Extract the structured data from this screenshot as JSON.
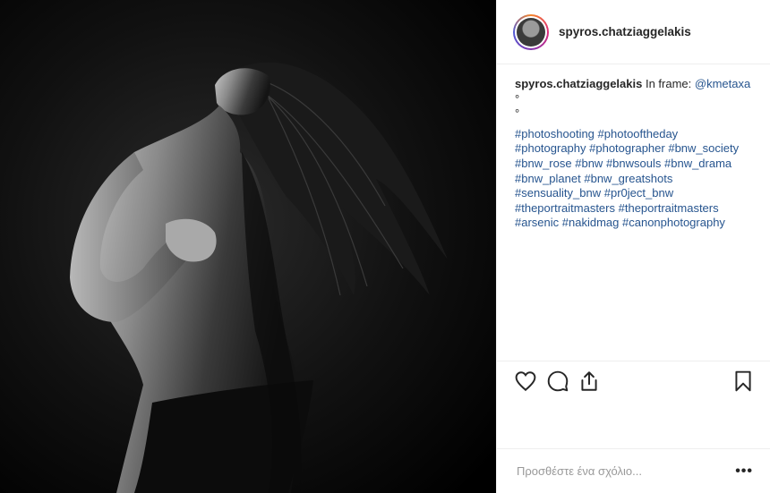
{
  "post": {
    "username": "spyros.chatziaggelakis",
    "caption": {
      "author": "spyros.chatziaggelakis",
      "text_prefix": "In frame:",
      "mention": "@kmetaxa",
      "dots": [
        "°",
        "°"
      ],
      "hashtag_lines": [
        [
          "#photoshooting",
          "#photooftheday"
        ],
        [
          "#photography",
          "#photographer",
          "#bnw_society"
        ],
        [
          "#bnw_rose",
          "#bnw",
          "#bnwsouls",
          "#bnw_drama"
        ],
        [
          "#bnw_planet",
          "#bnw_greatshots"
        ],
        [
          "#sensuality_bnw",
          "#pr0ject_bnw"
        ],
        [
          "#theportraitmasters",
          "#theportraitmasters"
        ],
        [
          "#arsenic",
          "#nakidmag",
          "#canonphotography"
        ]
      ]
    },
    "actions": {
      "like_icon": "heart-icon",
      "comment_icon": "comment-icon",
      "share_icon": "share-icon",
      "save_icon": "bookmark-icon"
    },
    "comment": {
      "placeholder": "Προσθέστε ένα σχόλιο...",
      "more_label": "•••"
    },
    "colors": {
      "link": "#27558f",
      "text": "#262626",
      "border": "#efefef"
    }
  }
}
